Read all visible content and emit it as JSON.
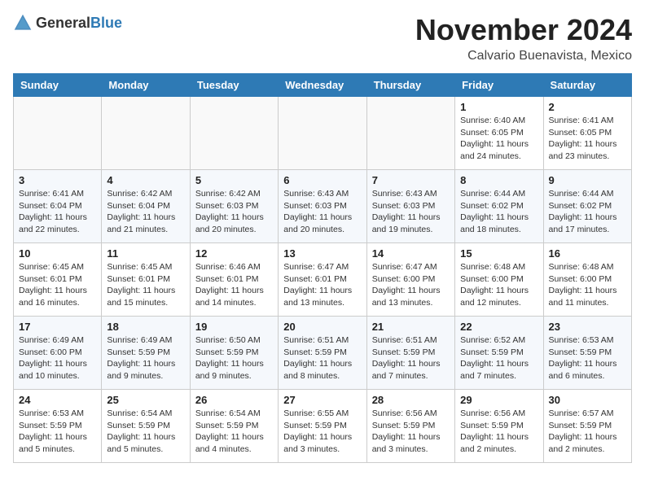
{
  "header": {
    "logo_general": "General",
    "logo_blue": "Blue",
    "month_title": "November 2024",
    "location": "Calvario Buenavista, Mexico"
  },
  "weekdays": [
    "Sunday",
    "Monday",
    "Tuesday",
    "Wednesday",
    "Thursday",
    "Friday",
    "Saturday"
  ],
  "weeks": [
    [
      {
        "day": "",
        "info": ""
      },
      {
        "day": "",
        "info": ""
      },
      {
        "day": "",
        "info": ""
      },
      {
        "day": "",
        "info": ""
      },
      {
        "day": "",
        "info": ""
      },
      {
        "day": "1",
        "info": "Sunrise: 6:40 AM\nSunset: 6:05 PM\nDaylight: 11 hours and 24 minutes."
      },
      {
        "day": "2",
        "info": "Sunrise: 6:41 AM\nSunset: 6:05 PM\nDaylight: 11 hours and 23 minutes."
      }
    ],
    [
      {
        "day": "3",
        "info": "Sunrise: 6:41 AM\nSunset: 6:04 PM\nDaylight: 11 hours and 22 minutes."
      },
      {
        "day": "4",
        "info": "Sunrise: 6:42 AM\nSunset: 6:04 PM\nDaylight: 11 hours and 21 minutes."
      },
      {
        "day": "5",
        "info": "Sunrise: 6:42 AM\nSunset: 6:03 PM\nDaylight: 11 hours and 20 minutes."
      },
      {
        "day": "6",
        "info": "Sunrise: 6:43 AM\nSunset: 6:03 PM\nDaylight: 11 hours and 20 minutes."
      },
      {
        "day": "7",
        "info": "Sunrise: 6:43 AM\nSunset: 6:03 PM\nDaylight: 11 hours and 19 minutes."
      },
      {
        "day": "8",
        "info": "Sunrise: 6:44 AM\nSunset: 6:02 PM\nDaylight: 11 hours and 18 minutes."
      },
      {
        "day": "9",
        "info": "Sunrise: 6:44 AM\nSunset: 6:02 PM\nDaylight: 11 hours and 17 minutes."
      }
    ],
    [
      {
        "day": "10",
        "info": "Sunrise: 6:45 AM\nSunset: 6:01 PM\nDaylight: 11 hours and 16 minutes."
      },
      {
        "day": "11",
        "info": "Sunrise: 6:45 AM\nSunset: 6:01 PM\nDaylight: 11 hours and 15 minutes."
      },
      {
        "day": "12",
        "info": "Sunrise: 6:46 AM\nSunset: 6:01 PM\nDaylight: 11 hours and 14 minutes."
      },
      {
        "day": "13",
        "info": "Sunrise: 6:47 AM\nSunset: 6:01 PM\nDaylight: 11 hours and 13 minutes."
      },
      {
        "day": "14",
        "info": "Sunrise: 6:47 AM\nSunset: 6:00 PM\nDaylight: 11 hours and 13 minutes."
      },
      {
        "day": "15",
        "info": "Sunrise: 6:48 AM\nSunset: 6:00 PM\nDaylight: 11 hours and 12 minutes."
      },
      {
        "day": "16",
        "info": "Sunrise: 6:48 AM\nSunset: 6:00 PM\nDaylight: 11 hours and 11 minutes."
      }
    ],
    [
      {
        "day": "17",
        "info": "Sunrise: 6:49 AM\nSunset: 6:00 PM\nDaylight: 11 hours and 10 minutes."
      },
      {
        "day": "18",
        "info": "Sunrise: 6:49 AM\nSunset: 5:59 PM\nDaylight: 11 hours and 9 minutes."
      },
      {
        "day": "19",
        "info": "Sunrise: 6:50 AM\nSunset: 5:59 PM\nDaylight: 11 hours and 9 minutes."
      },
      {
        "day": "20",
        "info": "Sunrise: 6:51 AM\nSunset: 5:59 PM\nDaylight: 11 hours and 8 minutes."
      },
      {
        "day": "21",
        "info": "Sunrise: 6:51 AM\nSunset: 5:59 PM\nDaylight: 11 hours and 7 minutes."
      },
      {
        "day": "22",
        "info": "Sunrise: 6:52 AM\nSunset: 5:59 PM\nDaylight: 11 hours and 7 minutes."
      },
      {
        "day": "23",
        "info": "Sunrise: 6:53 AM\nSunset: 5:59 PM\nDaylight: 11 hours and 6 minutes."
      }
    ],
    [
      {
        "day": "24",
        "info": "Sunrise: 6:53 AM\nSunset: 5:59 PM\nDaylight: 11 hours and 5 minutes."
      },
      {
        "day": "25",
        "info": "Sunrise: 6:54 AM\nSunset: 5:59 PM\nDaylight: 11 hours and 5 minutes."
      },
      {
        "day": "26",
        "info": "Sunrise: 6:54 AM\nSunset: 5:59 PM\nDaylight: 11 hours and 4 minutes."
      },
      {
        "day": "27",
        "info": "Sunrise: 6:55 AM\nSunset: 5:59 PM\nDaylight: 11 hours and 3 minutes."
      },
      {
        "day": "28",
        "info": "Sunrise: 6:56 AM\nSunset: 5:59 PM\nDaylight: 11 hours and 3 minutes."
      },
      {
        "day": "29",
        "info": "Sunrise: 6:56 AM\nSunset: 5:59 PM\nDaylight: 11 hours and 2 minutes."
      },
      {
        "day": "30",
        "info": "Sunrise: 6:57 AM\nSunset: 5:59 PM\nDaylight: 11 hours and 2 minutes."
      }
    ]
  ]
}
